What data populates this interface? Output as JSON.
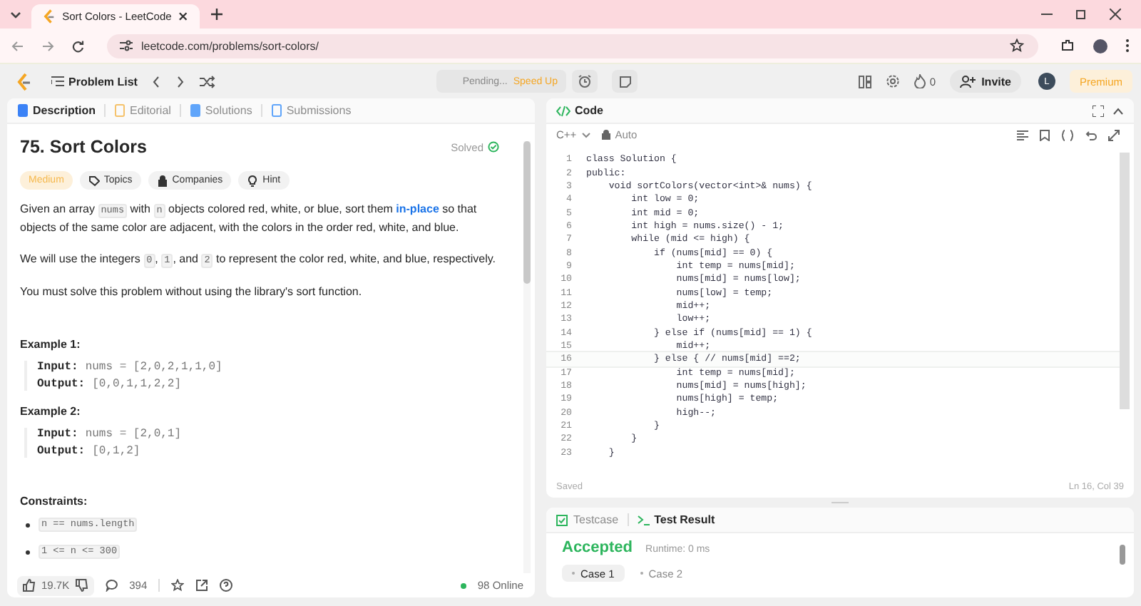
{
  "browser": {
    "tab_title": "Sort Colors - LeetCode",
    "url": "leetcode.com/problems/sort-colors/"
  },
  "header": {
    "problem_list": "Problem List",
    "pending": "Pending...",
    "speed_up": "Speed Up",
    "streak": "0",
    "invite": "Invite",
    "avatar": "L",
    "premium": "Premium"
  },
  "description": {
    "tabs": [
      {
        "label": "Description",
        "selected": true
      },
      {
        "label": "Editorial",
        "selected": false
      },
      {
        "label": "Solutions",
        "selected": false
      },
      {
        "label": "Submissions",
        "selected": false
      }
    ],
    "title": "75. Sort Colors",
    "status": "Solved",
    "difficulty": "Medium",
    "tags": [
      "Topics",
      "Companies",
      "Hint"
    ],
    "paragraphs": [
      [
        {
          "kind": "text",
          "text": "Given an array "
        },
        {
          "kind": "code",
          "text": "nums"
        },
        {
          "kind": "text",
          "text": " with "
        },
        {
          "kind": "code",
          "text": "n"
        },
        {
          "kind": "text",
          "text": " objects colored red, white, or blue, sort them "
        },
        {
          "kind": "link",
          "text": "in-place"
        },
        {
          "kind": "text",
          "text": " so that objects of the same color are adjacent, with the colors in the order red, white, and blue."
        }
      ],
      [
        {
          "kind": "text",
          "text": "We will use the integers "
        },
        {
          "kind": "code",
          "text": "0"
        },
        {
          "kind": "text",
          "text": ", "
        },
        {
          "kind": "code",
          "text": "1"
        },
        {
          "kind": "text",
          "text": ", and "
        },
        {
          "kind": "code",
          "text": "2"
        },
        {
          "kind": "text",
          "text": " to represent the color red, white, and blue, respectively."
        }
      ],
      [
        {
          "kind": "text",
          "text": "You must solve this problem without using the library's sort function."
        }
      ]
    ],
    "examples": [
      {
        "title": "Example 1:",
        "input_label": "Input:",
        "input": "nums = [2,0,2,1,1,0]",
        "output_label": "Output:",
        "output": "[0,0,1,1,2,2]"
      },
      {
        "title": "Example 2:",
        "input_label": "Input:",
        "input": "nums = [2,0,1]",
        "output_label": "Output:",
        "output": "[0,1,2]"
      }
    ],
    "constraints_title": "Constraints:",
    "constraints": [
      "n == nums.length",
      "1 <= n <= 300"
    ],
    "footer": {
      "likes": "19.7K",
      "comments": "394",
      "online": "98 Online"
    }
  },
  "code": {
    "title": "Code",
    "language": "C++",
    "mode": "Auto",
    "lines": [
      {
        "number": "1",
        "text": "class Solution {",
        "current": false
      },
      {
        "number": "2",
        "text": "public:",
        "current": false
      },
      {
        "number": "3",
        "text": "    void sortColors(vector<int>& nums) {",
        "current": false
      },
      {
        "number": "4",
        "text": "        int low = 0;",
        "current": false
      },
      {
        "number": "5",
        "text": "        int mid = 0;",
        "current": false
      },
      {
        "number": "6",
        "text": "        int high = nums.size() - 1;",
        "current": false
      },
      {
        "number": "7",
        "text": "        while (mid <= high) {",
        "current": false
      },
      {
        "number": "8",
        "text": "            if (nums[mid] == 0) {",
        "current": false
      },
      {
        "number": "9",
        "text": "                int temp = nums[mid];",
        "current": false
      },
      {
        "number": "10",
        "text": "                nums[mid] = nums[low];",
        "current": false
      },
      {
        "number": "11",
        "text": "                nums[low] = temp;",
        "current": false
      },
      {
        "number": "12",
        "text": "                mid++;",
        "current": false
      },
      {
        "number": "13",
        "text": "                low++;",
        "current": false
      },
      {
        "number": "14",
        "text": "            } else if (nums[mid] == 1) {",
        "current": false
      },
      {
        "number": "15",
        "text": "                mid++;",
        "current": false
      },
      {
        "number": "16",
        "text": "            } else { // nums[mid] ==2;",
        "current": true
      },
      {
        "number": "17",
        "text": "                int temp = nums[mid];",
        "current": false
      },
      {
        "number": "18",
        "text": "                nums[mid] = nums[high];",
        "current": false
      },
      {
        "number": "19",
        "text": "                nums[high] = temp;",
        "current": false
      },
      {
        "number": "20",
        "text": "                high--;",
        "current": false
      },
      {
        "number": "21",
        "text": "            }",
        "current": false
      },
      {
        "number": "22",
        "text": "        }",
        "current": false
      },
      {
        "number": "23",
        "text": "    }",
        "current": false
      }
    ],
    "status": "Saved",
    "cursor": "Ln 16, Col 39"
  },
  "result": {
    "tabs": [
      {
        "label": "Testcase",
        "selected": false
      },
      {
        "label": "Test Result",
        "selected": true
      }
    ],
    "verdict": "Accepted",
    "runtime": "Runtime: 0 ms",
    "cases": [
      {
        "label": "Case 1",
        "selected": true
      },
      {
        "label": "Case 2",
        "selected": false
      }
    ]
  }
}
